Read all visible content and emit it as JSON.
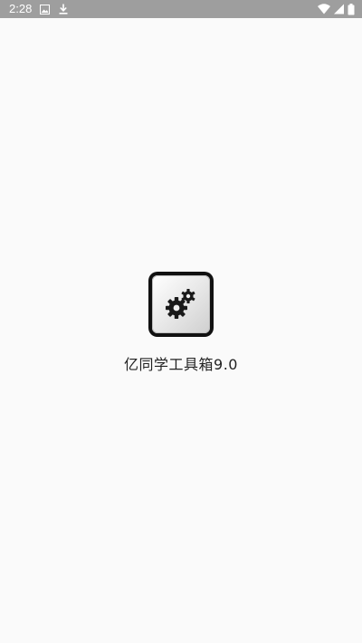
{
  "status_bar": {
    "time": "2:28",
    "left_icons": [
      "image-icon",
      "download-icon"
    ],
    "right_icons": [
      "wifi-icon",
      "signal-icon",
      "battery-icon"
    ],
    "background": "#9e9e9e"
  },
  "splash": {
    "app_name": "亿同学工具箱9.0",
    "icon": "gears-icon"
  }
}
